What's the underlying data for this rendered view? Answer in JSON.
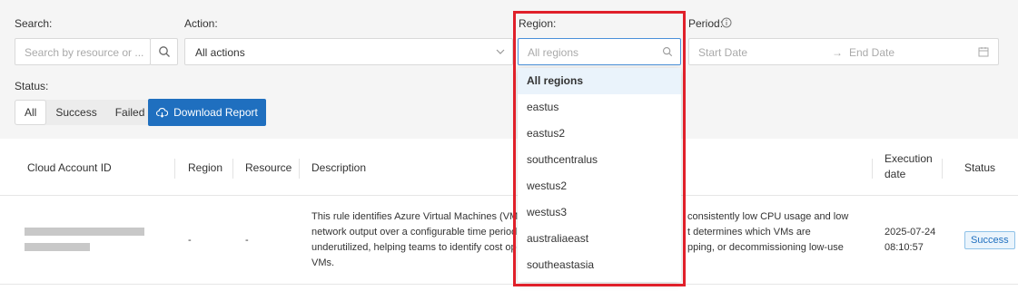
{
  "filters": {
    "search_label": "Search:",
    "search_placeholder": "Search by resource or ...",
    "action_label": "Action:",
    "action_value": "All actions",
    "region_label": "Region:",
    "region_placeholder": "All regions",
    "period_label": "Period:",
    "start_date_placeholder": "Start Date",
    "end_date_placeholder": "End Date",
    "arrow_text": "→",
    "status_label": "Status:",
    "status_options": [
      "All",
      "Success",
      "Failed"
    ],
    "download_label": "Download Report"
  },
  "region_dropdown": {
    "options": [
      "All regions",
      "eastus",
      "eastus2",
      "southcentralus",
      "westus2",
      "westus3",
      "australiaeast",
      "southeastasia"
    ]
  },
  "table": {
    "headers": {
      "cloud_account_id": "Cloud Account ID",
      "region": "Region",
      "resource": "Resource",
      "description": "Description",
      "execution_date_line1": "Execution",
      "execution_date_line2": "date",
      "status": "Status"
    },
    "row": {
      "region": "-",
      "resource": "-",
      "desc_left": [
        "This rule identifies Azure Virtual Machines (VMs",
        "network output over a configurable time period",
        "underutilized, helping teams to identify cost op",
        "VMs."
      ],
      "desc_right": [
        "consistently low CPU usage and low",
        "t determines which VMs are",
        "pping, or decommissioning low-use"
      ],
      "exec_date": "2025-07-24",
      "exec_time": "08:10:57",
      "status": "Success"
    }
  },
  "colors": {
    "accent": "#1f6fbf",
    "highlight": "#e0202a"
  }
}
